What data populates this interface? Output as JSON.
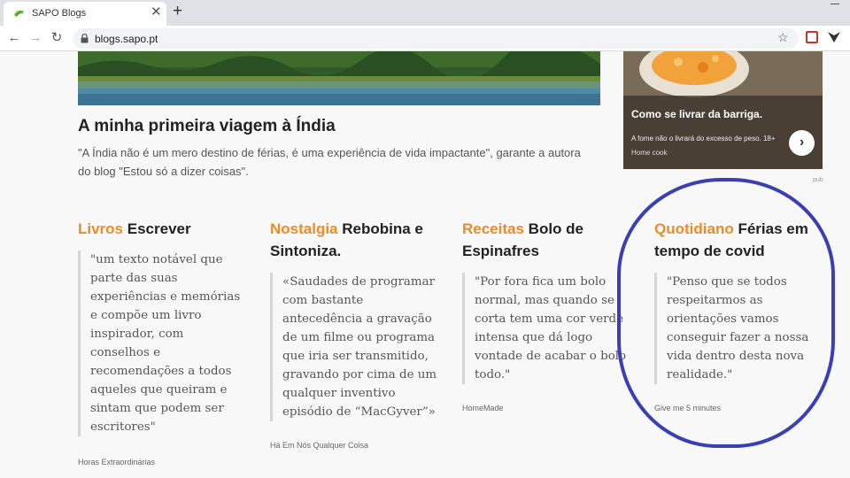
{
  "browser": {
    "tab_title": "SAPO Blogs",
    "url": "blogs.sapo.pt"
  },
  "feature": {
    "title": "A minha primeira viagem à Índia",
    "description": "\"A Índia não é um mero destino de férias, é uma experiência de vida impactante\", garante a autora do blog \"Estou só a dizer coisas\"."
  },
  "ad": {
    "title": "Como se livrar da barriga.",
    "description": "A fome não o livrará do excesso de peso. 18+",
    "source": "Home cook",
    "pub_label": "pub"
  },
  "posts": [
    {
      "category": "Livros",
      "title": "Escrever",
      "quote": "\"um texto notável que parte das suas experiências e memórias e compõe um livro inspirador, com conselhos e recomendações a todos aqueles que queiram e sintam que podem ser escritores\"",
      "source": "Horas Extraordinárias"
    },
    {
      "category": "Nostalgia",
      "title": "Rebobina e Sintoniza.",
      "quote": "«Saudades de programar com bastante antecedência a gravação de um filme ou programa que iria ser transmitido, gravando por cima de um qualquer inventivo episódio de “MacGyver”»",
      "source": "Há Em Nós Qualquer Coisa"
    },
    {
      "category": "Receitas",
      "title": "Bolo de Espinafres",
      "quote": "\"Por fora fica um bolo normal, mas quando se corta tem uma cor verde intensa que dá logo vontade de acabar o bolo todo.\"",
      "source": "HomeMade"
    },
    {
      "category": "Quotidiano",
      "title": "Férias em tempo de covid",
      "quote": "\"Penso que se todos respeitarmos as orientações vamos conseguir fazer a nossa vida dentro desta nova realidade.\"",
      "source": "Give me 5 minutes"
    }
  ],
  "colors": {
    "category_accent": "#f08a24",
    "annotation_circle": "#3a3fb3"
  }
}
